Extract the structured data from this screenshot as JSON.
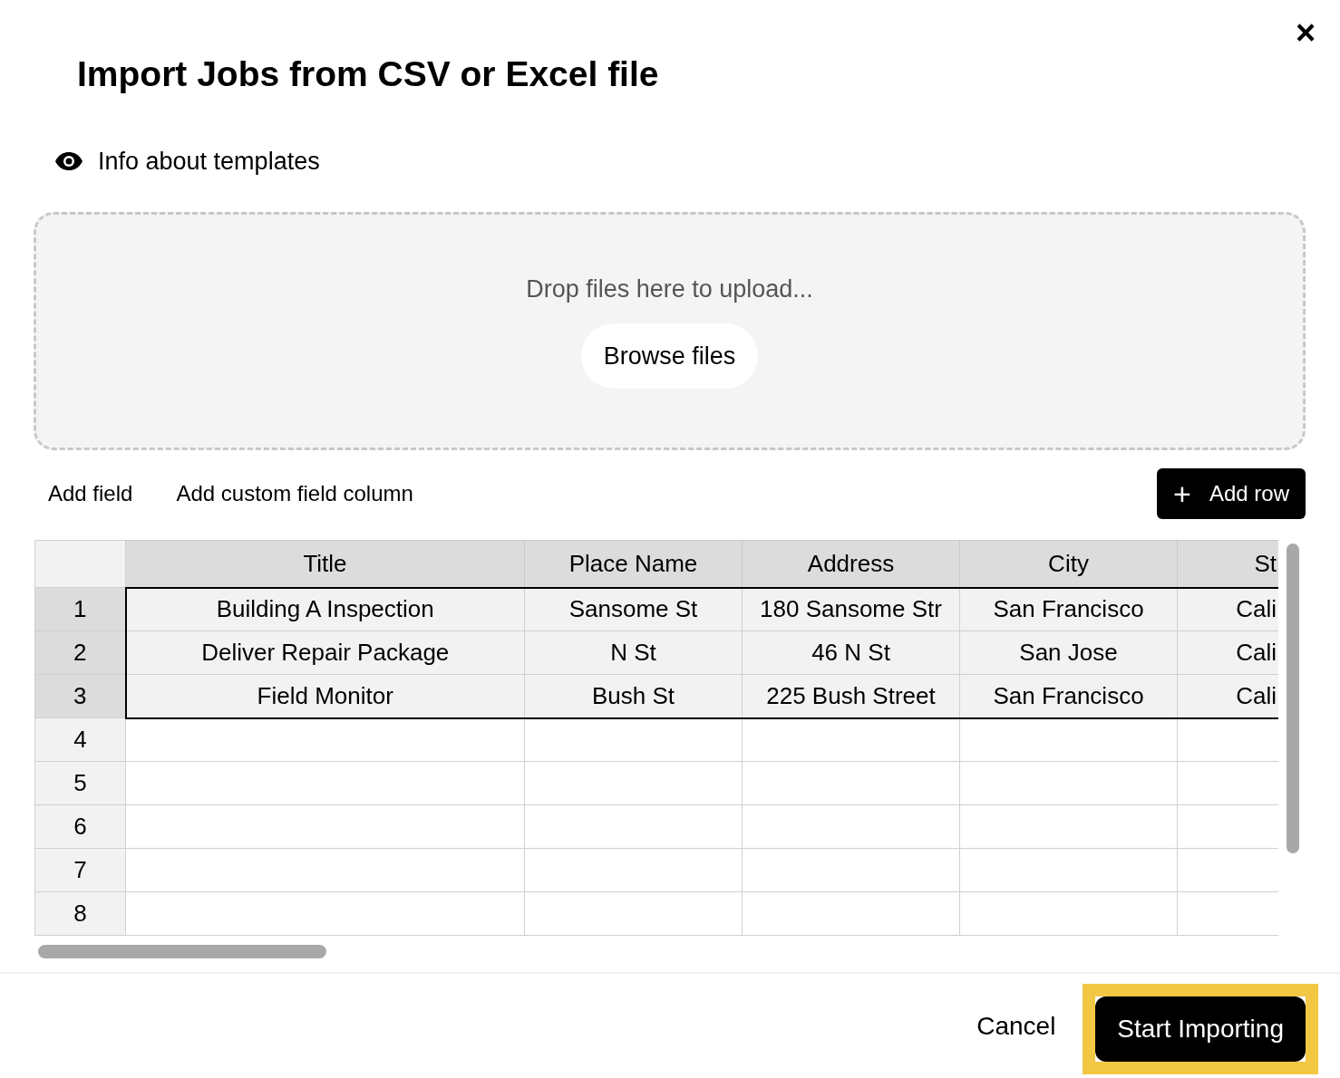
{
  "dialog": {
    "title": "Import Jobs from CSV or Excel file",
    "close": "×"
  },
  "info_link": "Info about templates",
  "dropzone": {
    "hint": "Drop files here to upload...",
    "button": "Browse files"
  },
  "toolbar": {
    "links": [
      "Add field",
      "Add custom field column"
    ],
    "add_row": {
      "icon": "+",
      "label": "Add row"
    }
  },
  "table": {
    "columns": [
      "Title",
      "Place Name",
      "Address",
      "City",
      "St"
    ],
    "rows": [
      {
        "number": "1",
        "selected": true,
        "cells": [
          "Building A Inspection",
          "Sansome St",
          "180 Sansome Str",
          "San Francisco",
          "Cali"
        ]
      },
      {
        "number": "2",
        "selected": true,
        "cells": [
          "Deliver Repair Package",
          "N St",
          "46 N St",
          "San Jose",
          "Cali"
        ]
      },
      {
        "number": "3",
        "selected": true,
        "cells": [
          "Field Monitor",
          "Bush St",
          "225 Bush Street",
          "San Francisco",
          "Cali"
        ]
      },
      {
        "number": "4",
        "selected": false,
        "cells": []
      },
      {
        "number": "5",
        "selected": false,
        "cells": []
      },
      {
        "number": "6",
        "selected": false,
        "cells": []
      },
      {
        "number": "7",
        "selected": false,
        "cells": []
      },
      {
        "number": "8",
        "selected": false,
        "cells": []
      }
    ]
  },
  "footer": {
    "cancel": "Cancel",
    "submit": "Start Importing"
  }
}
